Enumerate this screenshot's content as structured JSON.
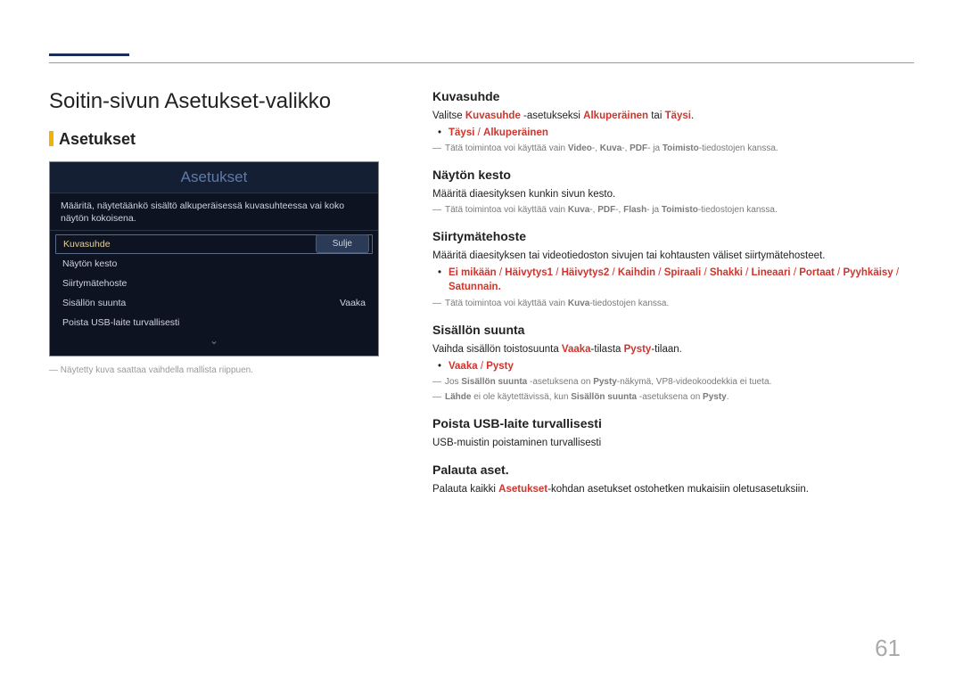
{
  "page": {
    "number": "61"
  },
  "left": {
    "title": "Soitin-sivun Asetukset-valikko",
    "subtitle": "Asetukset",
    "caption": "Näytetty kuva saattaa vaihdella mallista riippuen."
  },
  "scr": {
    "title": "Asetukset",
    "desc": "Määritä, näytetäänkö sisältö alkuperäisessä kuvasuhteessa vai koko näytön kokoisena.",
    "items": {
      "i0": "Kuvasuhde",
      "i1": "Näytön kesto",
      "i2": "Siirtymätehoste",
      "i3": "Sisällön suunta",
      "i3v": "Vaaka",
      "i4": "Poista USB-laite turvallisesti"
    },
    "close": "Sulje"
  },
  "s0": {
    "h": "Kuvasuhde",
    "p1a": "Valitse ",
    "p1b": "Kuvasuhde",
    "p1c": " -asetukseksi ",
    "p1d": "Alkuperäinen",
    "p1e": " tai ",
    "p1f": "Täysi",
    "p1g": ".",
    "b1": "Täysi",
    "b1s": " / ",
    "b1b": "Alkuperäinen",
    "d1a": "Tätä toimintoa voi käyttää vain ",
    "d1b": "Video",
    "d1c": "-, ",
    "d1d": "Kuva",
    "d1e": "-, ",
    "d1f": "PDF",
    "d1g": "- ja ",
    "d1h": "Toimisto",
    "d1i": "-tiedostojen kanssa."
  },
  "s1": {
    "h": "Näytön kesto",
    "p1": "Määritä diaesityksen kunkin sivun kesto.",
    "d1a": "Tätä toimintoa voi käyttää vain ",
    "d1b": "Kuva",
    "d1c": "-, ",
    "d1d": "PDF",
    "d1e": "-, ",
    "d1f": "Flash",
    "d1g": "- ja ",
    "d1h": "Toimisto",
    "d1i": "-tiedostojen kanssa."
  },
  "s2": {
    "h": "Siirtymätehoste",
    "p1": "Määritä diaesityksen tai videotiedoston sivujen tai kohtausten väliset siirtymätehosteet.",
    "b": [
      "Ei mikään",
      "Häivytys1",
      "Häivytys2",
      "Kaihdin",
      "Spiraali",
      "Shakki",
      "Lineaari",
      "Portaat",
      "Pyyhkäisy",
      "Satunnain."
    ],
    "d1a": "Tätä toimintoa voi käyttää vain ",
    "d1b": "Kuva",
    "d1c": "-tiedostojen kanssa."
  },
  "s3": {
    "h": "Sisällön suunta",
    "p1a": "Vaihda sisällön toistosuunta ",
    "p1b": "Vaaka",
    "p1c": "-tilasta ",
    "p1d": "Pysty",
    "p1e": "-tilaan.",
    "b1": "Vaaka",
    "b1s": " / ",
    "b1b": "Pysty",
    "d1a": "Jos ",
    "d1b": "Sisällön suunta",
    "d1c": " -asetuksena on ",
    "d1d": "Pysty",
    "d1e": "-näkymä, VP8-videokoodekkia ei tueta.",
    "d2a": "Lähde",
    "d2b": " ei ole käytettävissä, kun ",
    "d2c": "Sisällön suunta",
    "d2d": " -asetuksena on ",
    "d2e": "Pysty",
    "d2f": "."
  },
  "s4": {
    "h": "Poista USB-laite turvallisesti",
    "p1": "USB-muistin poistaminen turvallisesti"
  },
  "s5": {
    "h": "Palauta aset.",
    "p1a": "Palauta kaikki ",
    "p1b": "Asetukset",
    "p1c": "-kohdan asetukset ostohetken mukaisiin oletusasetuksiin."
  }
}
